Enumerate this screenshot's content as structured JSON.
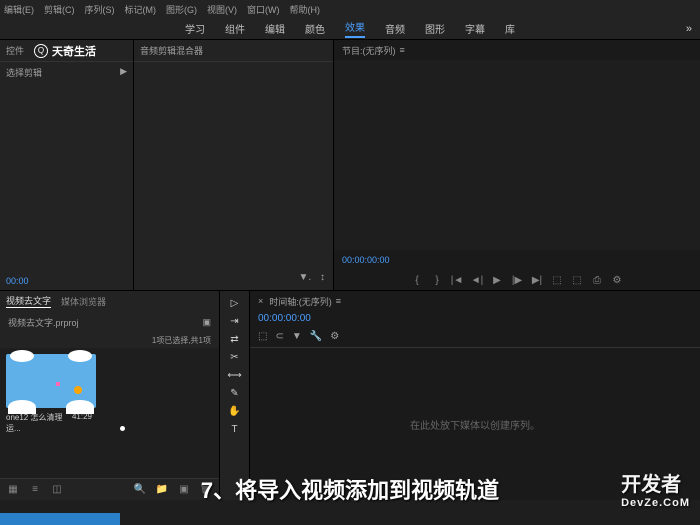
{
  "menu": {
    "edit": "编辑(E)",
    "clip": "剪辑(C)",
    "sequence": "序列(S)",
    "markers": "标记(M)",
    "graphics": "图形(G)",
    "view": "视图(V)",
    "window": "窗口(W)",
    "help": "帮助(H)"
  },
  "workspace": {
    "learn": "学习",
    "assembly": "组件",
    "editing": "编辑",
    "color": "颜色",
    "effects": "效果",
    "audio": "音频",
    "graphics": "图形",
    "captions": "字幕",
    "library": "库"
  },
  "left_panel": {
    "controls_tab": "控件",
    "audio_mixer": "音频剪辑混合器",
    "brand_name": "天奇生活",
    "no_clip_selected": "选择剪辑"
  },
  "program_monitor": {
    "title": "节目:(无序列)",
    "timecode": "00:00:00:00"
  },
  "source_monitor": {
    "timecode": "00:00"
  },
  "project": {
    "tab1": "视频去文字",
    "tab2": "媒体浏览器",
    "filename": "视频去文字.prproj",
    "selection_info": "1项已选择,共1项",
    "clip_name": "one12 怎么清理运...",
    "clip_duration": "41:29"
  },
  "timeline": {
    "title": "时间轴:(无序列)",
    "timecode": "00:00:00:00",
    "placeholder": "在此处放下媒体以创建序列。"
  },
  "caption": "7、将导入视频添加到视频轨道",
  "watermark": {
    "main": "开发者",
    "sub": "DevZe.CoM"
  }
}
